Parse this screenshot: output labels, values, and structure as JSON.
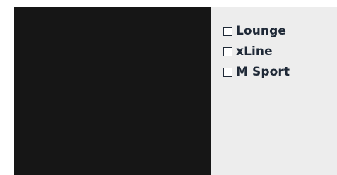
{
  "preview": {
    "background": "#161616"
  },
  "options": {
    "background": "#ededed",
    "text_color": "#1f2937",
    "items": [
      {
        "label": "Lounge",
        "checked": false
      },
      {
        "label": "xLine",
        "checked": false
      },
      {
        "label": "M Sport",
        "checked": false
      }
    ]
  }
}
